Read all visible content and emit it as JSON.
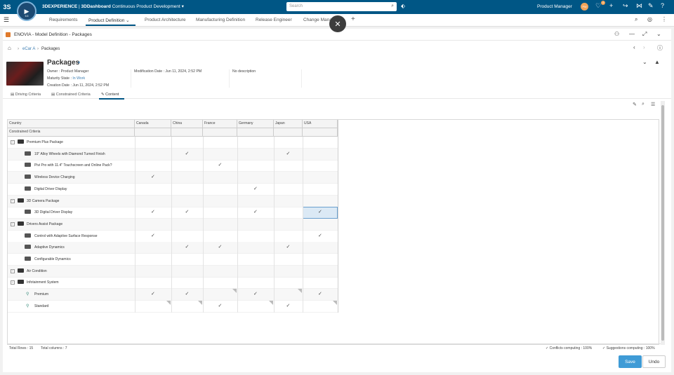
{
  "topbar": {
    "brand_3dx": "3DEXPERIENCE",
    "brand_sep": " | ",
    "brand_dash": "3DDashboard",
    "dashboard_name": "Continuous Product Development",
    "search_placeholder": "Search",
    "user_name": "Product Manager",
    "avatar_initials": "PM",
    "notif_count": "4",
    "compass_version": "6.6"
  },
  "tabs": [
    {
      "label": "Requirements"
    },
    {
      "label": "Product Definition"
    },
    {
      "label": "Product Architecture"
    },
    {
      "label": "Manufacturing Definition"
    },
    {
      "label": "Release Engineer"
    },
    {
      "label": "Change Management"
    }
  ],
  "app": {
    "title": "ENOVIA - Model Definition - Packages"
  },
  "breadcrumb": [
    "eCar A",
    "Packages"
  ],
  "object": {
    "title": "Packages",
    "owner_label": "Owner : ",
    "owner": "Product Manager",
    "maturity_label": "Maturity State : ",
    "maturity": "In Work",
    "creation_label": "Creation Date : ",
    "creation": "Jun 11, 2024, 2:52 PM",
    "modification_label": "Modification Date : ",
    "modification": "Jun 11, 2024, 2:52 PM",
    "description": "No description"
  },
  "subtabs": [
    {
      "label": "Driving Criteria"
    },
    {
      "label": "Constrained Criteria"
    },
    {
      "label": "Content"
    }
  ],
  "grid": {
    "header_country": "Country",
    "header_constrained": "Constrained Criteria",
    "columns": [
      "Canada",
      "China",
      "France",
      "Germany",
      "Japan",
      "USA"
    ],
    "rows": [
      {
        "label": "Premium Plus Package",
        "level": 0,
        "checks": [
          0,
          0,
          0,
          0,
          0,
          0
        ],
        "corners": [
          0,
          0,
          0,
          0,
          0,
          0
        ]
      },
      {
        "label": "19\" Alloy Wheels with Diamond Turned Finish",
        "level": 1,
        "checks": [
          0,
          1,
          0,
          0,
          1,
          0
        ],
        "corners": [
          0,
          0,
          0,
          0,
          0,
          0
        ]
      },
      {
        "label": "Pivi Pro with 11.4\" Touchscreen and Online Pack?",
        "level": 1,
        "checks": [
          0,
          0,
          1,
          0,
          0,
          0
        ],
        "corners": [
          0,
          0,
          0,
          0,
          0,
          0
        ]
      },
      {
        "label": "Wireless Device Charging",
        "level": 1,
        "checks": [
          1,
          0,
          0,
          0,
          0,
          0
        ],
        "corners": [
          0,
          0,
          0,
          0,
          0,
          0
        ]
      },
      {
        "label": "Digital Driver Display",
        "level": 1,
        "checks": [
          0,
          0,
          0,
          1,
          0,
          0
        ],
        "corners": [
          0,
          0,
          0,
          0,
          0,
          0
        ]
      },
      {
        "label": "3D Camera Package",
        "level": 0,
        "checks": [
          0,
          0,
          0,
          0,
          0,
          0
        ],
        "corners": [
          0,
          0,
          0,
          0,
          0,
          0
        ]
      },
      {
        "label": "3D Digital Driver Display",
        "level": 1,
        "checks": [
          1,
          1,
          0,
          1,
          0,
          1
        ],
        "corners": [
          0,
          0,
          0,
          0,
          0,
          0
        ]
      },
      {
        "label": "Drivers Assist Package",
        "level": 0,
        "checks": [
          0,
          0,
          0,
          0,
          0,
          0
        ],
        "corners": [
          0,
          0,
          0,
          0,
          0,
          0
        ]
      },
      {
        "label": "Control with Adaptive Surface Response",
        "level": 1,
        "checks": [
          1,
          0,
          0,
          0,
          0,
          1
        ],
        "corners": [
          0,
          0,
          0,
          0,
          0,
          0
        ]
      },
      {
        "label": "Adaptive Dynamics",
        "level": 1,
        "checks": [
          0,
          1,
          1,
          0,
          1,
          0
        ],
        "corners": [
          0,
          0,
          0,
          0,
          0,
          0
        ]
      },
      {
        "label": "Configurable Dynamics",
        "level": 1,
        "checks": [
          0,
          0,
          0,
          0,
          0,
          0
        ],
        "corners": [
          0,
          0,
          0,
          0,
          0,
          0
        ]
      },
      {
        "label": "Air Condition",
        "level": 0,
        "checks": [
          0,
          0,
          0,
          0,
          0,
          0
        ],
        "corners": [
          0,
          0,
          0,
          0,
          0,
          0
        ]
      },
      {
        "label": "Infotainment System",
        "level": 0,
        "checks": [
          0,
          0,
          0,
          0,
          0,
          0
        ],
        "corners": [
          0,
          0,
          0,
          0,
          0,
          0
        ]
      },
      {
        "label": "Premium",
        "level": 1,
        "checks": [
          1,
          1,
          0,
          1,
          0,
          1
        ],
        "corners": [
          0,
          0,
          1,
          0,
          1,
          0
        ],
        "leaf": true
      },
      {
        "label": "Standard",
        "level": 1,
        "checks": [
          0,
          0,
          1,
          0,
          1,
          0
        ],
        "corners": [
          1,
          1,
          0,
          1,
          0,
          1
        ],
        "leaf": true
      }
    ],
    "check_glyph": "✓"
  },
  "footer": {
    "total_rows": "Total Rows : 15",
    "total_columns": "Total columns : 7",
    "conflicts": "Conflicts computing : 100%",
    "suggestions": "Suggestions computing : 100%"
  },
  "buttons": {
    "save": "Save",
    "undo": "Undo"
  },
  "colors": {
    "topbar": "#005685",
    "accent": "#3f9bd6",
    "link": "#3f7fb3"
  }
}
